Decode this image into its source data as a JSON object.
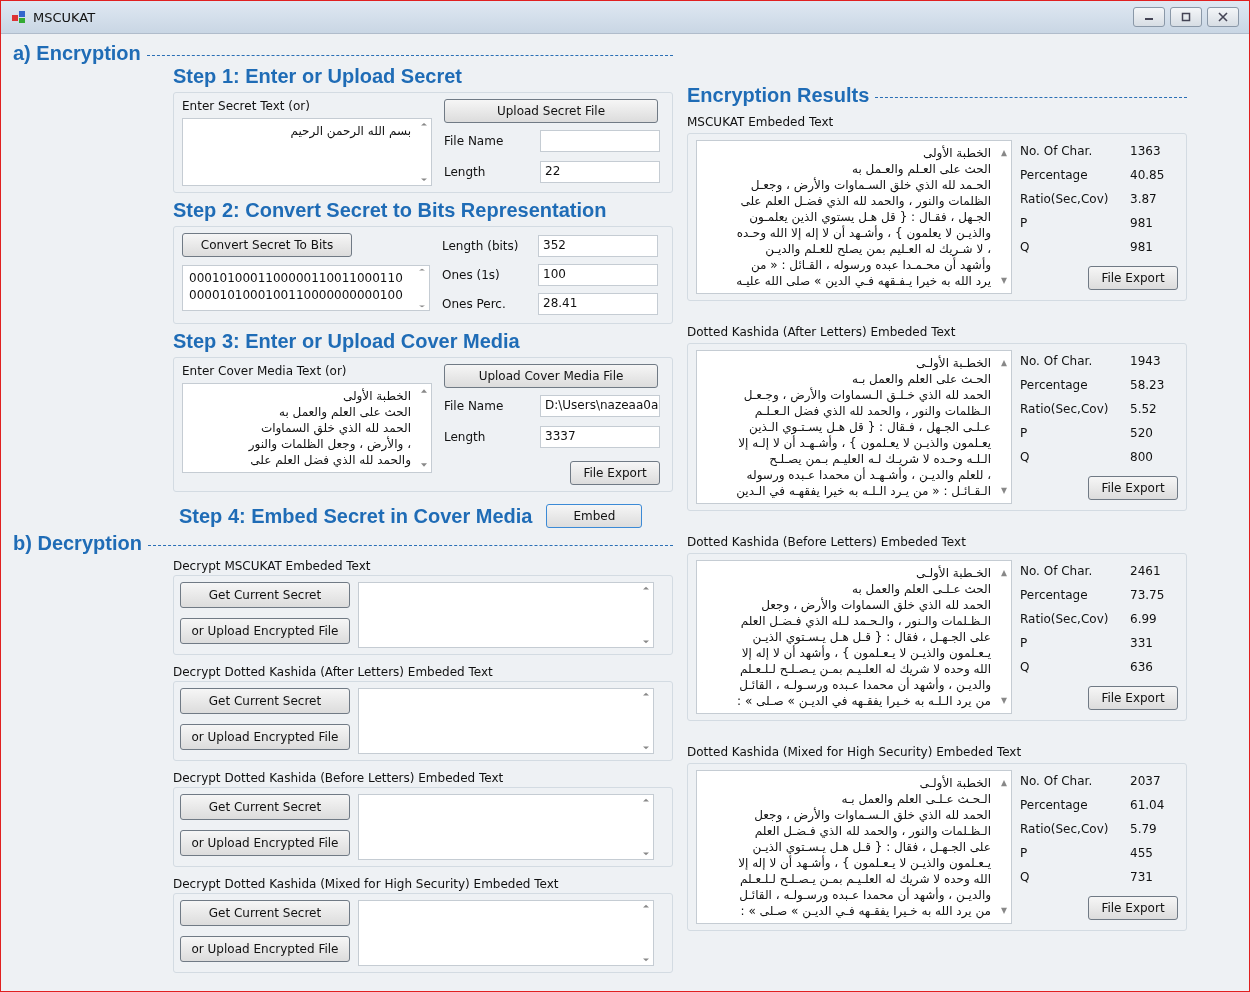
{
  "window": {
    "title": "MSCUKAT"
  },
  "encryption": {
    "heading": "a) Encryption",
    "step1": {
      "title": "Step 1: Enter or Upload Secret",
      "label": "Enter Secret Text (or)",
      "text_lines": [
        "بسم الله الرحمن الرحيم"
      ],
      "upload_button": "Upload Secret File",
      "fields": [
        {
          "label": "File Name"
        },
        {
          "label": "Length",
          "value": "22"
        }
      ]
    },
    "step2": {
      "title": "Step 2: Convert Secret to Bits Representation",
      "convert_button": "Convert Secret To Bits",
      "text_lines": [
        "0001010001100000110011000110",
        "0000101000100110000000000100"
      ],
      "fields": [
        {
          "label": "Length (bits)",
          "value": "352"
        },
        {
          "label": "Ones (1s)",
          "value": "100"
        },
        {
          "label": "Ones Perc.",
          "value": "28.41"
        }
      ]
    },
    "step3": {
      "title": "Step 3: Enter or Upload Cover Media",
      "label": "Enter Cover Media Text (or)",
      "text_lines": [
        "الخطبة الأولى",
        "الحث على العلم والعمل به",
        "الحمد لله الذي خلق السماوات",
        "، والأرض ، وجعل الظلمات والنور",
        "والحمد لله الذي فضل العلم على"
      ],
      "upload_button": "Upload Cover Media File",
      "fields": [
        {
          "label": "File Name",
          "value": "D:\\Users\\nazeaa0a"
        },
        {
          "label": "Length",
          "value": "3337"
        }
      ],
      "export_button": "File Export"
    },
    "step4": {
      "title": "Step 4: Embed Secret in Cover Media",
      "embed_button": "Embed"
    }
  },
  "decryption": {
    "heading": "b) Decryption",
    "groups": [
      {
        "title": "Decrypt MSCUKAT Embeded Text",
        "get_button": "Get Current Secret",
        "upload_button": "or Upload Encrypted File"
      },
      {
        "title": "Decrypt Dotted Kashida (After Letters) Embeded Text",
        "get_button": "Get Current Secret",
        "upload_button": "or Upload Encrypted File"
      },
      {
        "title": "Decrypt Dotted Kashida (Before Letters) Embeded Text",
        "get_button": "Get Current Secret",
        "upload_button": "or Upload Encrypted File"
      },
      {
        "title": "Decrypt Dotted Kashida (Mixed for High Security) Embeded Text",
        "get_button": "Get Current Secret",
        "upload_button": "or Upload Encrypted File"
      }
    ]
  },
  "results": {
    "heading": "Encryption Results",
    "groups": [
      {
        "title": "MSCUKAT Embeded Text",
        "text_lines": [
          "الخطبة الأولى",
          "الحث على العـلم والعـمل به",
          "الحـمد لله الذي خلق السـماوات والأرض ، وجعـل",
          "الظلمات والنور ، والحمد لله الذي فضـل العلم على",
          "الجـهل ، فقـال : { قل هـل يستوي الذين يعلمـون",
          "والذيـن لا يعلمون } ، وأشـهد أن لا إله إلا الله وحـده",
          "، لا شـريك له العـليم بمن يصلح للعـلم والديـن",
          "وأشهد أن محـمـدا عبده ورسوله ، القـائل : « من",
          "يرد الله به خيرا يـفـقهه فـي الدين » صلى الله عليـه"
        ],
        "stats": [
          {
            "label": "No. Of Char.",
            "value": "1363"
          },
          {
            "label": "Percentage",
            "value": "40.85"
          },
          {
            "label": "Ratio(Sec,Cov)",
            "value": "3.87"
          },
          {
            "label": "P",
            "value": "981"
          },
          {
            "label": "Q",
            "value": "981"
          }
        ],
        "export_button": "File Export"
      },
      {
        "title": "Dotted Kashida (After Letters) Embeded Text",
        "text_lines": [
          "الخطـبة الأولـى",
          "الحـث على العلم والعمل بـه",
          "الحمد لله الذي خـلـق الـسماوات والأرض ، وجـعـل",
          "الـظلمات والنور ، والحمد لله الذي فضل الـعـلـم",
          "عـلـى الجـهل ، فـقال : { قل هـل يسـتـوي الـذين",
          "يعـلمون والذيـن لا يعـلمون } ، وأشـهـد أن لا إلـه إلا",
          "الـلـه وحـده لا شريـك لـه العليـم بـمن يصـلـح",
          "، للعلم والديـن ، وأشـهـد أن محمدا عـبده ورسوله",
          "الـقـائـل : « من يـرد الـلـه به خيرا يفقهـه في الـدين"
        ],
        "stats": [
          {
            "label": "No. Of Char.",
            "value": "1943"
          },
          {
            "label": "Percentage",
            "value": "58.23"
          },
          {
            "label": "Ratio(Sec,Cov)",
            "value": "5.52"
          },
          {
            "label": "P",
            "value": "520"
          },
          {
            "label": "Q",
            "value": "800"
          }
        ],
        "export_button": "File Export"
      },
      {
        "title": "Dotted Kashida (Before Letters) Embeded Text",
        "text_lines": [
          "الخـطبة الأولـى",
          "الحث عـلـى العلم والعمل به",
          "الحمد لله الذي خلق السماوات والأرض ، وجعل",
          "الـظـلمات والـنور ، والـحـمد لـله الذي فـضـل العلم",
          "على الجـهـل ، فقال : { قـل هـل يـسـتوي الذيـن",
          "يـعـلمون والذيـن لا يـعـلمون } ، وأشهد أن لا إله إلا",
          "الله وحده لا شريك له العلـيـم بمـن يـصـلـح لـلـعـلم",
          "والديـن ، وأشهد أن محمدا عـبده ورسـولـه ، القائـل",
          "من يرد الـلـه به خـيرا يفقـهه في الديـن » صـلى » :"
        ],
        "stats": [
          {
            "label": "No. Of Char.",
            "value": "2461"
          },
          {
            "label": "Percentage",
            "value": "73.75"
          },
          {
            "label": "Ratio(Sec,Cov)",
            "value": "6.99"
          },
          {
            "label": "P",
            "value": "331"
          },
          {
            "label": "Q",
            "value": "636"
          }
        ],
        "export_button": "File Export"
      },
      {
        "title": "Dotted Kashida (Mixed for High Security) Embeded Text",
        "text_lines": [
          "الخطبة الأولـى",
          "الـحـث عـلـى العلم والعمل بـه",
          "الحمد لله الذي خلق الـسـماوات والأرض ، وجعل",
          "الـظـلمات والنور ، والحمد لله الذي فـضـل العلم",
          "على الجـهـل ، فقال : { قـل هـل يـسـتوي الذيـن",
          "يـعـلمون والذيـن لا يـعـلمون } ، وأشـهد أن لا إله إلا",
          "الله وحده لا شريك له العلـيـم بمـن يـصـلـح لـلـعـلم",
          "والديـن ، وأشهد أن محمدا عـبده ورسـولـه ، القائـل",
          "من يرد الله به خـيرا يفقـهه فـي الديـن » صـلى » :"
        ],
        "stats": [
          {
            "label": "No. Of Char.",
            "value": "2037"
          },
          {
            "label": "Percentage",
            "value": "61.04"
          },
          {
            "label": "Ratio(Sec,Cov)",
            "value": "5.79"
          },
          {
            "label": "P",
            "value": "455"
          },
          {
            "label": "Q",
            "value": "731"
          }
        ],
        "export_button": "File Export"
      }
    ]
  }
}
